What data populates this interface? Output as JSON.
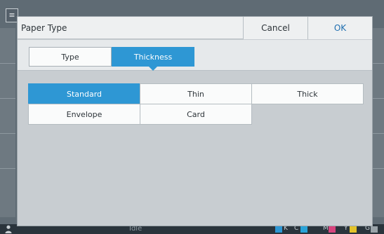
{
  "dialog": {
    "title": "Paper Type",
    "cancel_label": "Cancel",
    "ok_label": "OK"
  },
  "tabs": [
    {
      "label": "Type",
      "selected": false
    },
    {
      "label": "Thickness",
      "selected": true
    }
  ],
  "options": [
    {
      "label": "Standard",
      "selected": true
    },
    {
      "label": "Thin",
      "selected": false
    },
    {
      "label": "Thick",
      "selected": false
    },
    {
      "label": "Envelope",
      "selected": false
    },
    {
      "label": "Card",
      "selected": false
    }
  ],
  "status_bar": {
    "status_text": "Idle",
    "ink_labels": [
      "K",
      "C",
      "M",
      "Y",
      "G"
    ],
    "ink_colors": [
      "#2e97d4",
      "#2aa3d8",
      "#d8447e",
      "#e3c32a",
      "#9aa3a9"
    ]
  },
  "colors": {
    "accent": "#2e97d4",
    "dialog_bg": "#c8cdd1",
    "ok_text": "#1f6fb0"
  },
  "background_icon": "≡"
}
